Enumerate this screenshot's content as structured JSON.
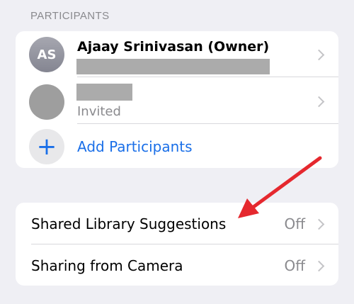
{
  "section_header": "PARTICIPANTS",
  "participants": [
    {
      "initials": "AS",
      "name": "Ajaay Srinivasan (Owner)",
      "subtitle_redacted": true
    },
    {
      "initials": "",
      "name_redacted": true,
      "status": "Invited"
    }
  ],
  "add_participants_label": "Add Participants",
  "add_icon": "plus-icon",
  "settings": [
    {
      "label": "Shared Library Suggestions",
      "value": "Off"
    },
    {
      "label": "Sharing from Camera",
      "value": "Off"
    }
  ],
  "colors": {
    "accent": "#1a6fe8",
    "annotation_arrow": "#e5282e",
    "background": "#efeff4"
  }
}
